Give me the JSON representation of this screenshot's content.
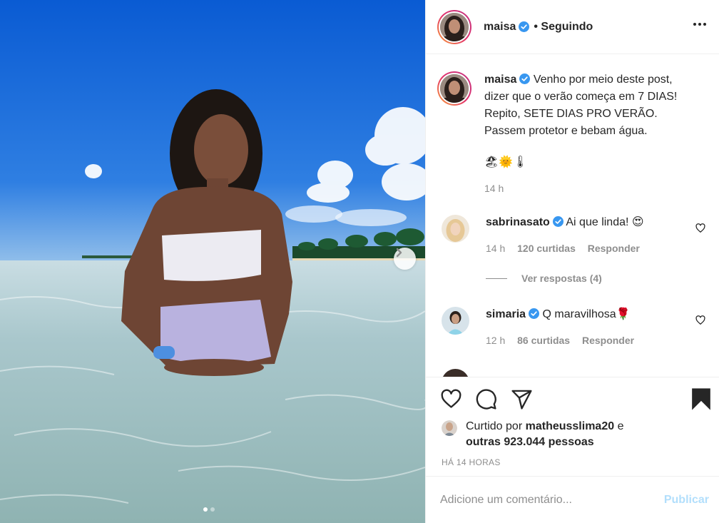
{
  "post": {
    "author": "maisa",
    "follow_status": "• Seguindo",
    "caption_text": "Venho por meio deste post, dizer que o verão começa em 7 DIAS! Repito, SETE DIAS PRO VERÃO. Passem protetor e bebam água.",
    "caption_emojis": "🏖🌞🌡",
    "caption_time": "14 h"
  },
  "comments": [
    {
      "user": "sabrinasato",
      "text": "Ai que linda! 😍",
      "time": "14 h",
      "likes": "120 curtidas",
      "reply_label": "Responder",
      "view_replies": "Ver respostas (4)"
    },
    {
      "user": "simaria",
      "text": "Q maravilhosa🌹",
      "time": "12 h",
      "likes": "86 curtidas",
      "reply_label": "Responder"
    }
  ],
  "liked_by": {
    "prefix": "Curtido por",
    "user": "matheusslima20",
    "joiner": "e",
    "others": "outras 923.044 pessoas"
  },
  "timestamp": "HÁ 14 HORAS",
  "comment_box": {
    "placeholder": "Adicione um comentário...",
    "publish_label": "Publicar"
  },
  "carousel": {
    "current": 1,
    "total": 2
  },
  "colors": {
    "verified": "#3897f0",
    "publish_disabled": "#b2dffc",
    "secondary_text": "#8e8e8e"
  }
}
